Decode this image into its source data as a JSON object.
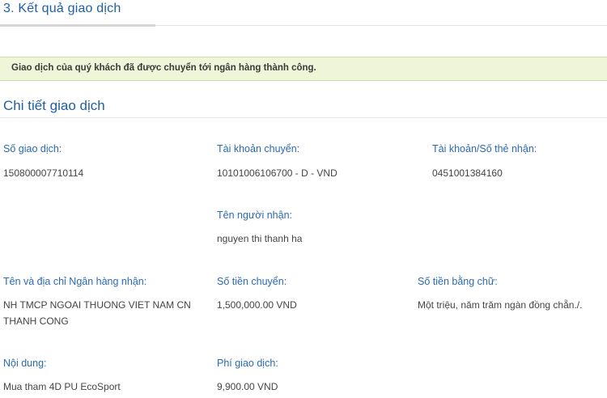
{
  "header": {
    "step_title": "3. Kết quả giao dịch"
  },
  "banner": {
    "message": "Giao dịch của quý khách đã được chuyển tới ngân hàng thành công."
  },
  "details": {
    "title": "Chi tiết giao dịch",
    "transaction_no": {
      "label": "Số giao dịch:",
      "value": "150800007710114"
    },
    "from_account": {
      "label": "Tài khoản chuyển:",
      "value": "10101006106700 - D - VND"
    },
    "to_account": {
      "label": "Tài khoản/Số thẻ nhận:",
      "value": "0451001384160"
    },
    "recipient_name": {
      "label": "Tên người nhận:",
      "value": "nguyen thi thanh ha"
    },
    "bank": {
      "label": "Tên và địa chỉ Ngân hàng nhận:",
      "value": "NH TMCP NGOAI THUONG VIET NAM CN THANH CONG"
    },
    "amount": {
      "label": "Số tiền chuyển:",
      "value": "1,500,000.00 VND"
    },
    "amount_words": {
      "label": "Số tiền bằng chữ:",
      "value": "Một triệu, năm trăm ngàn đồng chẵn./."
    },
    "content": {
      "label": "Nội dung:",
      "value": "Mua tham 4D PU EcoSport"
    },
    "fee": {
      "label": "Phí giao dịch:",
      "value": "9,900.00 VND"
    }
  }
}
